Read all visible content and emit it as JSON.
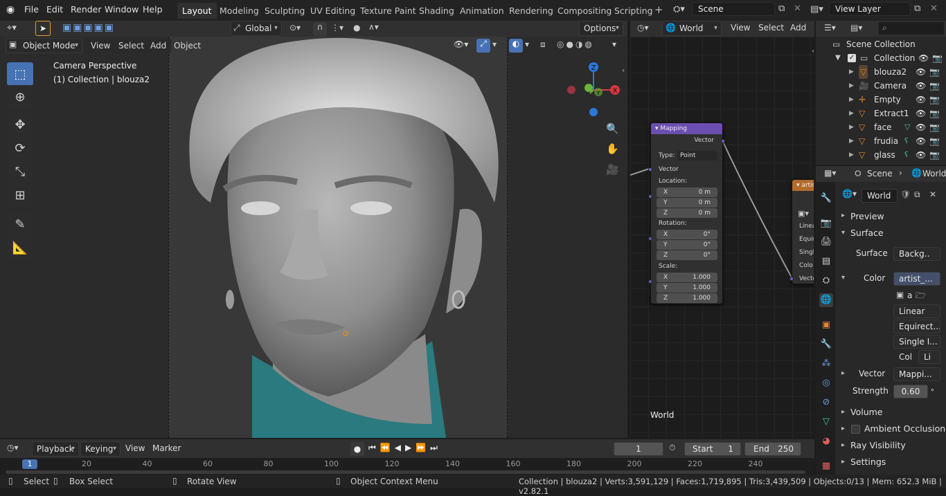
{
  "topbar": {
    "menus": [
      "File",
      "Edit",
      "Render",
      "Window",
      "Help"
    ],
    "workspaces": [
      "Layout",
      "Modeling",
      "Sculpting",
      "UV Editing",
      "Texture Paint",
      "Shading",
      "Animation",
      "Rendering",
      "Compositing",
      "Scripting"
    ],
    "active_workspace": "Layout",
    "add_symbol": "+",
    "scene_name": "Scene",
    "view_layer": "View Layer"
  },
  "viewport": {
    "transform_orientation": "Global",
    "options_label": "Options",
    "mode": "Object Mode",
    "menus": [
      "View",
      "Select",
      "Add",
      "Object"
    ],
    "overlay_title": "Camera Perspective",
    "overlay_sub": "(1) Collection | blouza2",
    "gizmo": {
      "z": "Z",
      "x": "X",
      "y": "Y"
    }
  },
  "node_editor": {
    "world_dropdown": "World",
    "menus": [
      "View",
      "Select",
      "Add"
    ],
    "label": "World",
    "mapping_node": {
      "title": "Mapping",
      "output": "Vector",
      "type_label": "Type:",
      "type_value": "Point",
      "input": "Vector",
      "location_label": "Location:",
      "location": [
        {
          "axis": "X",
          "value": "0 m"
        },
        {
          "axis": "Y",
          "value": "0 m"
        },
        {
          "axis": "Z",
          "value": "0 m"
        }
      ],
      "rotation_label": "Rotation:",
      "rotation": [
        {
          "axis": "X",
          "value": "0°"
        },
        {
          "axis": "Y",
          "value": "0°"
        },
        {
          "axis": "Z",
          "value": "0°"
        }
      ],
      "scale_label": "Scale:",
      "scale": [
        {
          "axis": "X",
          "value": "1.000"
        },
        {
          "axis": "Y",
          "value": "1.000"
        },
        {
          "axis": "Z",
          "value": "1.000"
        }
      ]
    },
    "image_node": {
      "title": "artis",
      "rows": [
        "Linea",
        "Equir",
        "Singl",
        "Colo",
        "Vecto"
      ]
    }
  },
  "outliner": {
    "root": "Scene Collection",
    "collection": "Collection",
    "items": [
      "blouza2",
      "Camera",
      "Empty",
      "Extract1",
      "face",
      "frudia",
      "glass"
    ]
  },
  "properties": {
    "scene_tab": "Scene",
    "world_tab": "World",
    "world_name": "World",
    "sections": {
      "preview": "Preview",
      "surface": "Surface",
      "volume": "Volume",
      "ao": "Ambient Occlusion",
      "ray_visibility": "Ray Visibility",
      "settings": "Settings"
    },
    "surface_label": "Surface",
    "surface_value": "Backg..",
    "color_label": "Color",
    "color_value": "artist_...",
    "image_text": "a",
    "interpolation": "Linear",
    "projection": "Equirect...",
    "source": "Single I...",
    "col_label": "Col",
    "col_value": "Li",
    "vector_label": "Vector",
    "vector_value": "Mappi...",
    "strength_label": "Strength",
    "strength_value": "0.60"
  },
  "timeline": {
    "menus": [
      "Playback",
      "Keying",
      "View",
      "Marker"
    ],
    "current_frame": "1",
    "start_label": "Start",
    "start_value": "1",
    "end_label": "End",
    "end_value": "250",
    "ruler": [
      "20",
      "40",
      "60",
      "80",
      "100",
      "120",
      "140",
      "160",
      "180",
      "200",
      "220",
      "240"
    ],
    "playhead": "1"
  },
  "statusbar": {
    "select": "Select",
    "box_select": "Box Select",
    "rotate_view": "Rotate View",
    "context_menu": "Object Context Menu",
    "stats": "Collection | blouza2 | Verts:3,591,129 | Faces:1,719,895 | Tris:3,439,509 | Objects:0/13 | Mem: 652.3 MiB | v2.82.1"
  },
  "colors": {
    "accent": "#4772b3",
    "mapping_header": "#6a4fb0",
    "image_header": "#b36b2c",
    "sweater": "#2a7a7f"
  }
}
